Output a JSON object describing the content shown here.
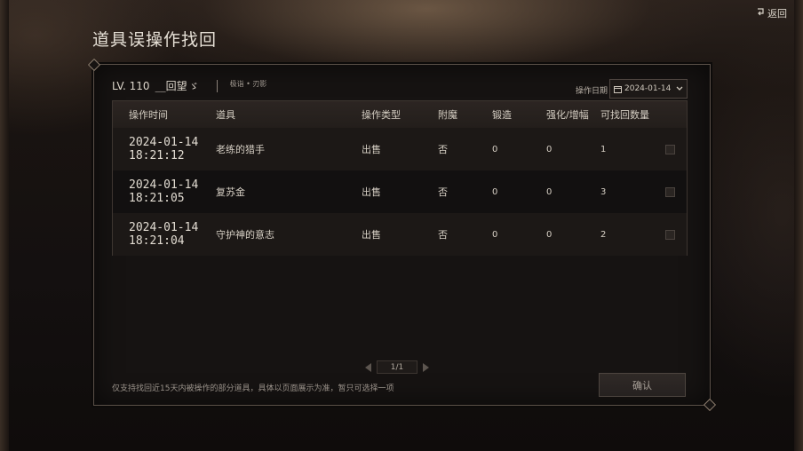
{
  "page": {
    "title": "道具误操作找回",
    "back_label": "返回"
  },
  "character": {
    "level": "LV. 110",
    "name": "__回望",
    "name_deco": "ゞ",
    "class": "极诣 • 刃影"
  },
  "date_filter": {
    "label": "操作日期",
    "value": "2024-01-14"
  },
  "table": {
    "headers": {
      "time": "操作时间",
      "item": "道具",
      "type": "操作类型",
      "enchant": "附魔",
      "forge": "锻造",
      "amplify": "强化/增幅",
      "qty": "可找回数量"
    },
    "rows": [
      {
        "date": "2024-01-14",
        "time": "18:21:12",
        "item": "老练的猎手",
        "type": "出售",
        "enchant": "否",
        "forge": "0",
        "amplify": "0",
        "qty": "1"
      },
      {
        "date": "2024-01-14",
        "time": "18:21:05",
        "item": "复苏金",
        "type": "出售",
        "enchant": "否",
        "forge": "0",
        "amplify": "0",
        "qty": "3"
      },
      {
        "date": "2024-01-14",
        "time": "18:21:04",
        "item": "守护神的意志",
        "type": "出售",
        "enchant": "否",
        "forge": "0",
        "amplify": "0",
        "qty": "2"
      }
    ]
  },
  "pager": {
    "text": "1/1"
  },
  "footer": {
    "note": "仅支持找回近15天内被操作的部分道具，具体以页面展示为准，暂只可选择一项",
    "confirm_label": "确认"
  },
  "colors": {
    "background": "#120d0b",
    "panel": "#161312",
    "border": "#5b5048",
    "text": "#cfc8bd"
  },
  "icons": [
    "back-icon",
    "calendar-icon",
    "chevron-down-icon",
    "prev-page-icon",
    "next-page-icon"
  ]
}
